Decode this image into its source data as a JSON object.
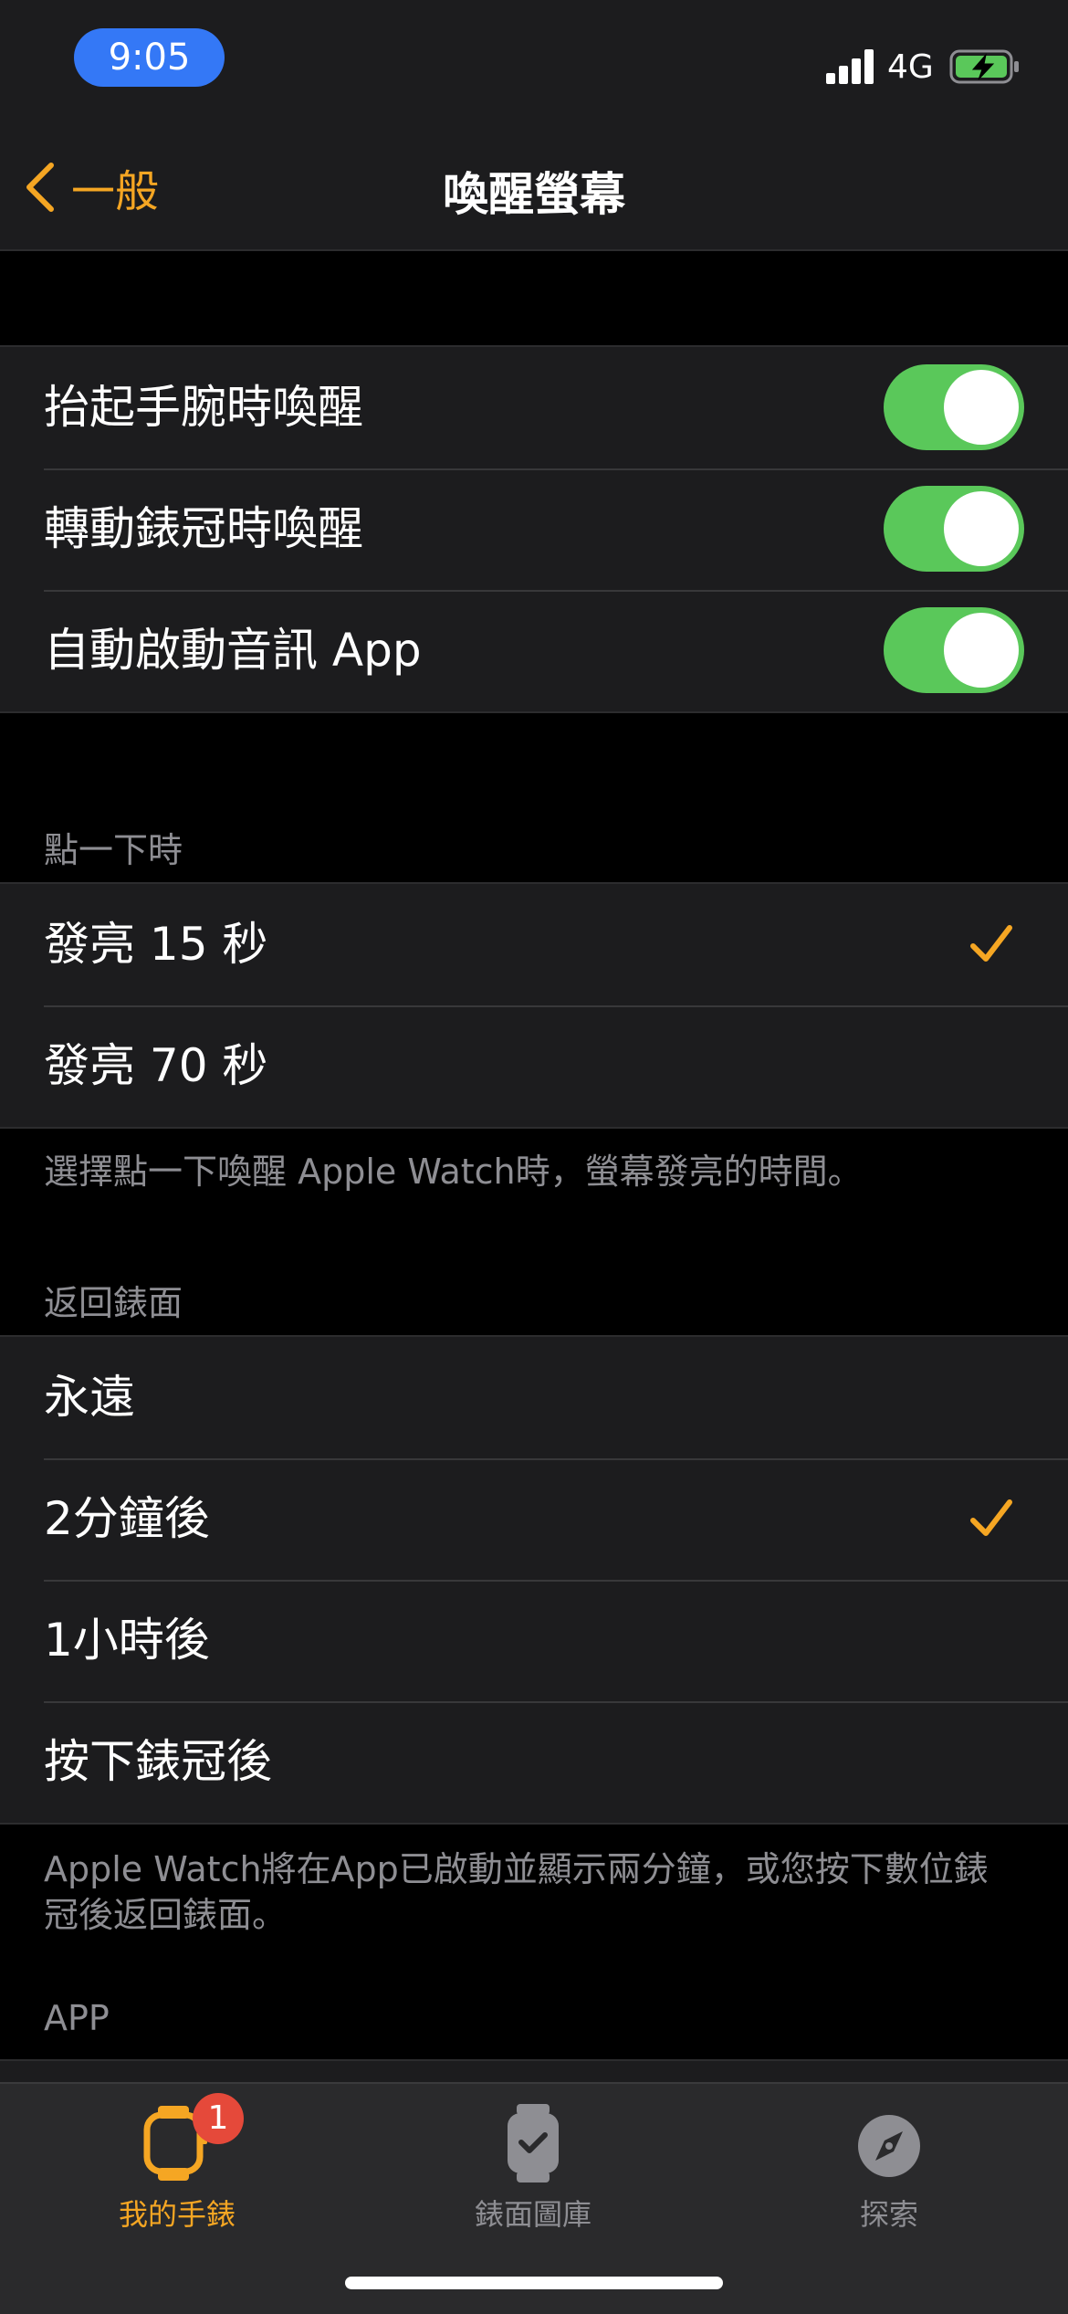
{
  "status": {
    "time": "9:05",
    "network": "4G"
  },
  "nav": {
    "back_label": "一般",
    "title": "喚醒螢幕"
  },
  "wake_group": {
    "items": [
      {
        "label": "抬起手腕時喚醒",
        "on": true
      },
      {
        "label": "轉動錶冠時喚醒",
        "on": true
      },
      {
        "label": "自動啟動音訊 App",
        "on": true
      }
    ]
  },
  "tap_section": {
    "header": "點一下時",
    "items": [
      {
        "label": "發亮 15 秒",
        "checked": true
      },
      {
        "label": "發亮 70 秒",
        "checked": false
      }
    ],
    "footnote": "選擇點一下喚醒 Apple Watch時，螢幕發亮的時間。"
  },
  "return_section": {
    "header": "返回錶面",
    "items": [
      {
        "label": "永遠",
        "checked": false
      },
      {
        "label": "2分鐘後",
        "checked": true
      },
      {
        "label": "1小時後",
        "checked": false
      },
      {
        "label": "按下錶冠後",
        "checked": false
      }
    ],
    "footnote": "Apple Watch將在App已啟動並顯示兩分鐘，或您按下數位錶冠後返回錶面。"
  },
  "app_section": {
    "header": "APP"
  },
  "tabbar": {
    "tabs": [
      {
        "label": "我的手錶",
        "badge": "1",
        "active": true,
        "icon": "watch-icon"
      },
      {
        "label": "錶面圖庫",
        "active": false,
        "icon": "watch-face-gallery-icon"
      },
      {
        "label": "探索",
        "active": false,
        "icon": "compass-icon"
      }
    ]
  },
  "colors": {
    "accent": "#f5a623",
    "toggle_on": "#5ac85a",
    "status_pill": "#3478f6",
    "badge": "#e5493a",
    "inactive_tab": "#8e8e93"
  }
}
